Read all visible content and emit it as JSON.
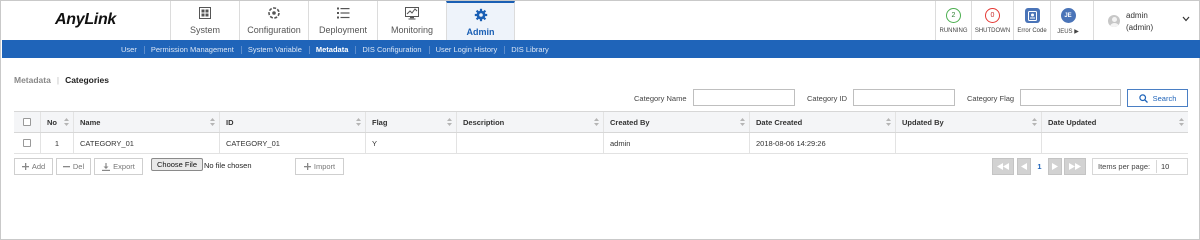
{
  "app": {
    "logo": "AnyLink"
  },
  "topnav": [
    {
      "label": "System",
      "icon": "grid-icon"
    },
    {
      "label": "Configuration",
      "icon": "gear-cluster-icon"
    },
    {
      "label": "Deployment",
      "icon": "list-icon"
    },
    {
      "label": "Monitoring",
      "icon": "monitor-icon"
    },
    {
      "label": "Admin",
      "icon": "gear-icon",
      "active": true
    }
  ],
  "status": {
    "running": {
      "count": "2",
      "label": "RUNNING",
      "color": "#4caf50"
    },
    "shutdown": {
      "count": "0",
      "label": "SHUTDOWN",
      "color": "#e53935"
    },
    "error": {
      "label": "Error Code"
    },
    "jeus": {
      "badge": "JE",
      "label": "JEUS ▶"
    }
  },
  "user": {
    "name": "admin",
    "role": "(admin)"
  },
  "subnav": [
    {
      "label": "User"
    },
    {
      "label": "Permission Management"
    },
    {
      "label": "System Variable"
    },
    {
      "label": "Metadata",
      "active": true
    },
    {
      "label": "DIS Configuration"
    },
    {
      "label": "User Login History"
    },
    {
      "label": "DIS Library"
    }
  ],
  "breadcrumb": {
    "parent": "Metadata",
    "current": "Categories"
  },
  "filters": {
    "category_name": {
      "label": "Category Name",
      "value": ""
    },
    "category_id": {
      "label": "Category ID",
      "value": ""
    },
    "category_flag": {
      "label": "Category Flag",
      "value": ""
    },
    "search_label": "Search"
  },
  "table": {
    "columns": [
      "No",
      "Name",
      "ID",
      "Flag",
      "Description",
      "Created By",
      "Date Created",
      "Updated By",
      "Date Updated"
    ],
    "rows": [
      {
        "no": "1",
        "name": "CATEGORY_01",
        "id": "CATEGORY_01",
        "flag": "Y",
        "description": "",
        "created_by": "admin",
        "date_created": "2018-08-06 14:29:26",
        "updated_by": "",
        "date_updated": ""
      }
    ]
  },
  "actions": {
    "add": "Add",
    "del": "Del",
    "export": "Export",
    "choose_file": "Choose File",
    "file_status": "No file chosen",
    "import": "Import"
  },
  "pagination": {
    "current_page": "1",
    "items_per_page_label": "Items per page:",
    "items_per_page": "10"
  },
  "colors": {
    "accent": "#1f64b9",
    "subnav_bg": "#1f64b9"
  }
}
